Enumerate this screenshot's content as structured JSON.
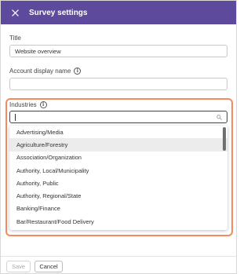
{
  "header": {
    "title": "Survey settings",
    "close_icon": "close-icon"
  },
  "form": {
    "title_label": "Title",
    "title_value": "Website overview",
    "account_label": "Account display name",
    "account_value": "",
    "industries_label": "Industries",
    "search_value": ""
  },
  "dropdown": {
    "options": [
      "Advertising/Media",
      "Agriculture/Forestry",
      "Association/Organization",
      "Authority, Local/Municipality",
      "Authority, Public",
      "Authority, Regional/State",
      "Banking/Finance",
      "Bar/Restaurant/Food Delivery"
    ],
    "hovered_index": 1
  },
  "footer": {
    "save_label": "Save",
    "cancel_label": "Cancel"
  },
  "colors": {
    "header": "#5e4a9c",
    "highlight": "#f28c5f"
  }
}
